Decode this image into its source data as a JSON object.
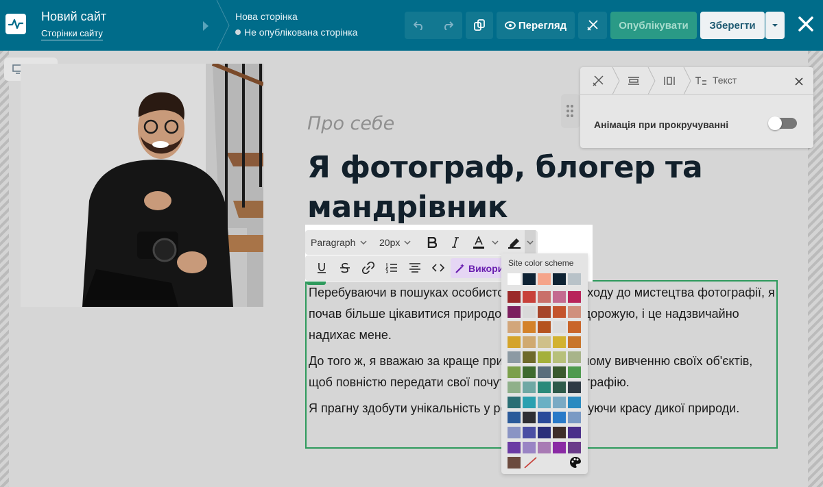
{
  "header": {
    "site_title": "Новий сайт",
    "site_pages_link": "Сторінки сайту",
    "page_name": "Нова сторінка",
    "page_status": "Не опублікована сторінка",
    "preview_label": "Перегляд",
    "publish_label": "Опублікувати",
    "save_label": "Зберегти",
    "icons": [
      "undo-icon",
      "redo-icon",
      "copy-style-icon",
      "eye-icon",
      "design-tools-icon",
      "chevron-down-icon",
      "close-icon"
    ]
  },
  "device_switcher": {
    "icons": [
      "desktop-icon",
      "mobile-icon"
    ]
  },
  "content": {
    "about_label": "Про себе",
    "heading": "Я фотограф, блогер та мандрівник",
    "paragraphs": [
      "Перебуваючи в пошуках особистого стиля та підходу до мистецтва фотографії, я почав більше цікавитися природою. Я багато подорожую, і це надзвичайно надихає мене.",
      "До того ж, я вважаю за краще приділяти детальному вивченню своїх об'єктів, щоб повністю передати свої почуття через фотографію.",
      "Я прагну здобути унікальність у роботах, зображуючи красу дикої природи."
    ]
  },
  "text_toolbar": {
    "paragraph_select": "Paragraph",
    "size_select": "20px",
    "ai_label": "Використати AI",
    "icons": [
      "bold-icon",
      "italic-icon",
      "text-color-icon",
      "highlight-icon",
      "underline-icon",
      "strikethrough-icon",
      "link-icon",
      "ordered-list-icon",
      "align-center-icon",
      "code-icon",
      "magic-wand-icon"
    ]
  },
  "color_palette": {
    "title": "Site color scheme",
    "scheme": [
      "#ffffff",
      "#0d2233",
      "#f5a48a",
      "#0d2233",
      "#b8c2c8"
    ],
    "grid": [
      [
        "#9b2a2a",
        "#c8413a",
        "#c9706a",
        "#c46a8f",
        "#b8245a"
      ],
      [
        "#7c1f5e",
        "#d9d9d9",
        "#a6452a",
        "#c4542c",
        "#d0907d"
      ],
      [
        "#d2a67a",
        "#d4822a",
        "#b5531f",
        "#dcdcdc",
        "#c9652a"
      ],
      [
        "#d4a42a",
        "#d0a970",
        "#cfc08a",
        "#d2b230",
        "#c8752a"
      ],
      [
        "#8c9aa3",
        "#6e6a2a",
        "#a4b03a",
        "#b7c07a",
        "#a8b48a"
      ],
      [
        "#7ba04a",
        "#3e6a2f",
        "#5a6e7c",
        "#3a5a2e",
        "#4e9a4e"
      ],
      [
        "#8fb08a",
        "#6fa8a4",
        "#2a8a7a",
        "#2e5a4a",
        "#2e3a44"
      ],
      [
        "#2a6e74",
        "#2aa0b0",
        "#6ab0c4",
        "#7aaac4",
        "#2a8ac0"
      ],
      [
        "#2a5a9a",
        "#2e2e34",
        "#2a4a9a",
        "#2a7ac8",
        "#7a9ac4"
      ],
      [
        "#8a94c4",
        "#4a4ea4",
        "#2a2e7a",
        "#3e2e2a",
        "#4a2e8a"
      ],
      [
        "#6a3aa4",
        "#9a84c4",
        "#a87ab4",
        "#8a2aa4",
        "#6a3a8a"
      ]
    ],
    "custom_swatch": "#6b4a3e",
    "icons": [
      "no-color-icon",
      "palette-icon"
    ]
  },
  "side_panel": {
    "tab_label": "Текст",
    "animation_label": "Анімація при прокручуванні",
    "animation_enabled": false,
    "icons": [
      "design-tools-icon",
      "layout-icon",
      "spacing-icon",
      "text-icon",
      "close-icon",
      "drag-handle-icon"
    ]
  },
  "colors": {
    "header_bg": "#006c8a",
    "publish_bg": "#2a9a86",
    "block_outline": "#2e9a5c",
    "ai_accent": "#6a1fb0"
  }
}
